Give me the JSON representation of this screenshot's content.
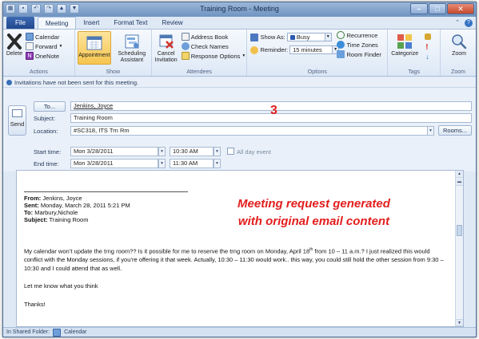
{
  "window": {
    "title": "Training Room - Meeting"
  },
  "tabs": [
    {
      "label": "File"
    },
    {
      "label": "Meeting"
    },
    {
      "label": "Insert"
    },
    {
      "label": "Format Text"
    },
    {
      "label": "Review"
    }
  ],
  "ribbon": {
    "actions": {
      "delete": "Delete",
      "calendar": "Calendar",
      "forward": "Forward",
      "onenote": "OneNote",
      "label": "Actions"
    },
    "show": {
      "appointment": "Appointment",
      "scheduling_1": "Scheduling",
      "scheduling_2": "Assistant",
      "label": "Show"
    },
    "attendees": {
      "cancel_1": "Cancel",
      "cancel_2": "Invitation",
      "address_book": "Address Book",
      "check_names": "Check Names",
      "response_options": "Response Options",
      "label": "Attendees"
    },
    "options": {
      "show_as_label": "Show As:",
      "show_as_value": "Busy",
      "reminder_label": "Reminder:",
      "reminder_value": "15 minutes",
      "recurrence": "Recurrence",
      "time_zones": "Time Zones",
      "room_finder": "Room Finder",
      "label": "Options"
    },
    "tags": {
      "categorize": "Categorize",
      "label": "Tags"
    },
    "zoom": {
      "zoom": "Zoom",
      "label": "Zoom"
    }
  },
  "info_bar": "Invitations have not been sent for this meeting.",
  "form": {
    "to_button": "To...",
    "to_value": "Jenkins, Joyce",
    "send_label": "Send",
    "subject_label": "Subject:",
    "subject_value": "Training Room",
    "location_label": "Location:",
    "location_value": "#SC318, ITS Trn Rm",
    "rooms_button": "Rooms...",
    "start_label": "Start time:",
    "start_date": "Mon 3/28/2011",
    "start_time": "10:30 AM",
    "all_day": "All day event",
    "end_label": "End time:",
    "end_date": "Mon 3/28/2011",
    "end_time": "11:30 AM"
  },
  "email": {
    "from_label": "From:",
    "from_value": " Jenkins, Joyce",
    "sent_label": "Sent:",
    "sent_value": " Monday, March 28, 2011 5:21 PM",
    "to_label": "To:",
    "to_value": " Marbury,Nichole",
    "subject_label": "Subject:",
    "subject_value": " Training Room",
    "body_1a": "My calendar won’t update the trng room?? Is it possible for me to reserve the trng room on Monday, April 18",
    "body_1sup": "th",
    "body_1b": " from 10 – 11 a.m.? I just realized this would conflict with the Monday sessions, if you’re offering it that week. Actually, 10:30 – 11:30 would work.. this way, you could still hold the other session from 9:30 – 10:30 and I could attend that as well.",
    "body_2": "Let me know what you think",
    "body_3": "Thanks!"
  },
  "annotation": {
    "number": "3",
    "line_1": "Meeting request generated",
    "line_2": "with original email content"
  },
  "status_bar": {
    "label": "In Shared Folder:",
    "folder": "Calendar"
  },
  "colors": {
    "accent": "#e31d1d",
    "file_tab": "#2a569e"
  }
}
